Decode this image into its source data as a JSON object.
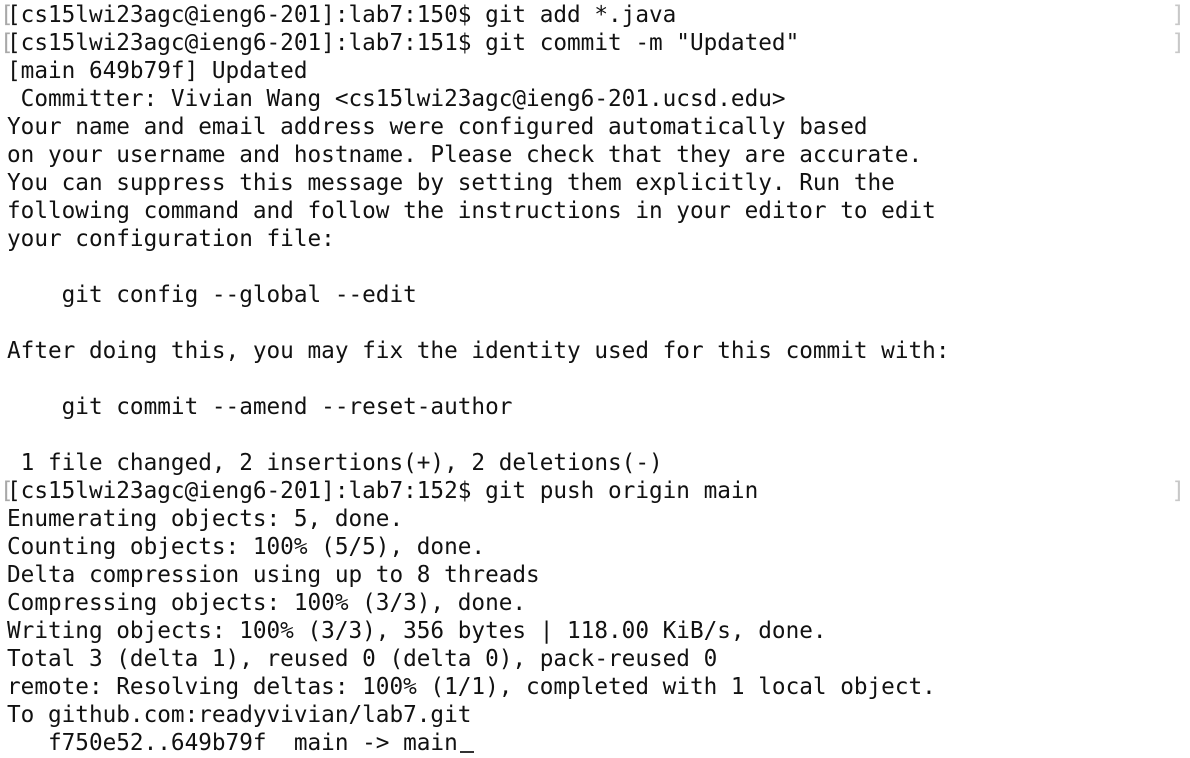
{
  "terminal": {
    "lines": [
      "[cs15lwi23agc@ieng6-201]:lab7:150$ git add *.java",
      "[cs15lwi23agc@ieng6-201]:lab7:151$ git commit -m \"Updated\"",
      "[main 649b79f] Updated",
      " Committer: Vivian Wang <cs15lwi23agc@ieng6-201.ucsd.edu>",
      "Your name and email address were configured automatically based",
      "on your username and hostname. Please check that they are accurate.",
      "You can suppress this message by setting them explicitly. Run the",
      "following command and follow the instructions in your editor to edit",
      "your configuration file:",
      "",
      "    git config --global --edit",
      "",
      "After doing this, you may fix the identity used for this commit with:",
      "",
      "    git commit --amend --reset-author",
      "",
      " 1 file changed, 2 insertions(+), 2 deletions(-)",
      "[cs15lwi23agc@ieng6-201]:lab7:152$ git push origin main",
      "Enumerating objects: 5, done.",
      "Counting objects: 100% (5/5), done.",
      "Delta compression using up to 8 threads",
      "Compressing objects: 100% (3/3), done.",
      "Writing objects: 100% (3/3), 356 bytes | 118.00 KiB/s, done.",
      "Total 3 (delta 1), reused 0 (delta 0), pack-reused 0",
      "remote: Resolving deltas: 100% (1/1), completed with 1 local object.",
      "To github.com:readyvivian/lab7.git",
      "   f750e52..649b79f  main -> main"
    ]
  }
}
